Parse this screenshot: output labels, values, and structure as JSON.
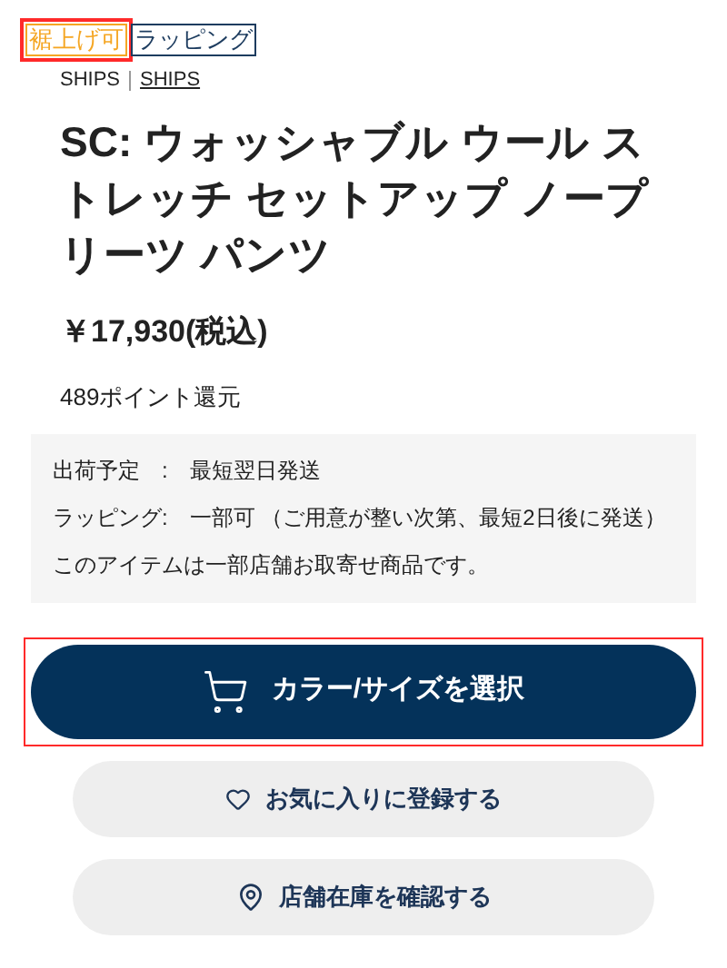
{
  "tags": [
    {
      "label": "裾上げ可",
      "kind": "accent",
      "highlighted": true
    },
    {
      "label": "ラッピング",
      "kind": "plain",
      "highlighted": false
    }
  ],
  "brands": [
    "SHIPS",
    "SHIPS"
  ],
  "title": "SC: ウォッシャブル ウール ストレッチ セットアップ ノープリーツ パンツ",
  "price": "￥17,930(税込)",
  "points": "489ポイント還元",
  "info": [
    "出荷予定　:　最短翌日発送",
    "ラッピング:　一部可 （ご用意が整い次第、最短2日後に発送）",
    "このアイテムは一部店舗お取寄せ商品です。"
  ],
  "primary_button": {
    "label": "カラー/サイズを選択",
    "highlighted": true
  },
  "secondary_buttons": [
    {
      "label": "お気に入りに登録する",
      "kind": "favorite"
    },
    {
      "label": "店舗在庫を確認する",
      "kind": "store"
    }
  ]
}
